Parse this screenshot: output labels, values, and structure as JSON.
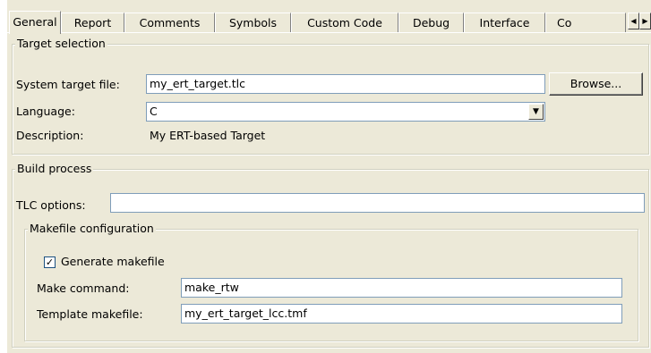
{
  "tabs": [
    {
      "label": "General",
      "active": true
    },
    {
      "label": "Report"
    },
    {
      "label": "Comments"
    },
    {
      "label": "Symbols"
    },
    {
      "label": "Custom Code"
    },
    {
      "label": "Debug"
    },
    {
      "label": "Interface"
    },
    {
      "label": "Co"
    }
  ],
  "tab_scroll": {
    "left_icon": "arrow-left-icon",
    "right_icon": "arrow-right-icon"
  },
  "target_selection": {
    "title": "Target selection",
    "system_target_file_label": "System target file:",
    "system_target_file_value": "my_ert_target.tlc",
    "browse_label": "Browse...",
    "language_label": "Language:",
    "language_value": "C",
    "description_label": "Description:",
    "description_value": "My ERT-based Target"
  },
  "build_process": {
    "title": "Build process",
    "tlc_options_label": "TLC options:",
    "tlc_options_value": "",
    "makefile": {
      "title": "Makefile configuration",
      "generate_makefile_label": "Generate makefile",
      "generate_makefile_checked": true,
      "make_command_label": "Make command:",
      "make_command_value": "make_rtw",
      "template_makefile_label": "Template makefile:",
      "template_makefile_value": "my_ert_target_lcc.tmf"
    }
  }
}
